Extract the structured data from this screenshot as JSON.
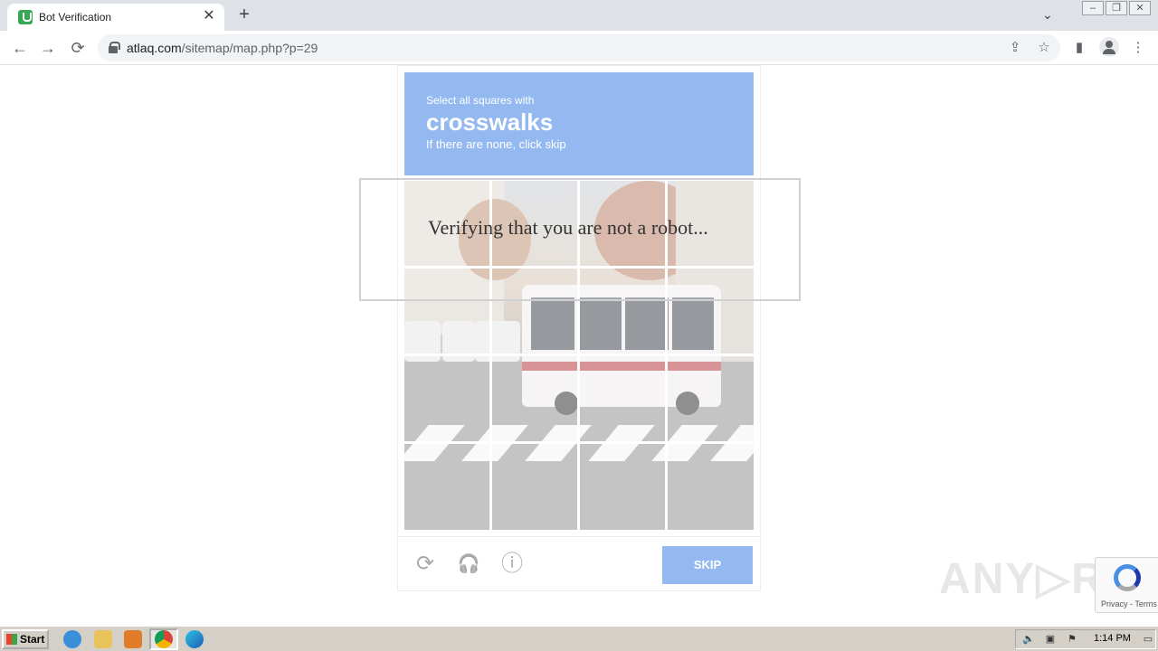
{
  "browser": {
    "tab_title": "Bot Verification",
    "tab_close": "✕",
    "new_tab": "+",
    "url_domain": "atlaq.com",
    "url_path": "/sitemap/map.php?p=29",
    "nav_back": "←",
    "nav_forward": "→",
    "nav_reload": "⟳",
    "tab_menu": "⌄",
    "window_minimize": "–",
    "window_restore": "❐",
    "window_close": "✕"
  },
  "captcha": {
    "prompt_line1": "Select all squares with",
    "prompt_target": "crosswalks",
    "prompt_line3": "If there are none, click skip",
    "skip_label": "SKIP",
    "reload_icon": "⟳",
    "audio_icon": "🎧",
    "info_icon": "ⓘ",
    "accent_color": "#2b76e5"
  },
  "overlay": {
    "text": "Verifying that you are not a robot..."
  },
  "watermark": {
    "text": "ANY▷RUN"
  },
  "recaptcha_badge": {
    "terms": "Privacy - Terms"
  },
  "taskbar": {
    "start_label": "Start",
    "clock": "1:14 PM"
  }
}
